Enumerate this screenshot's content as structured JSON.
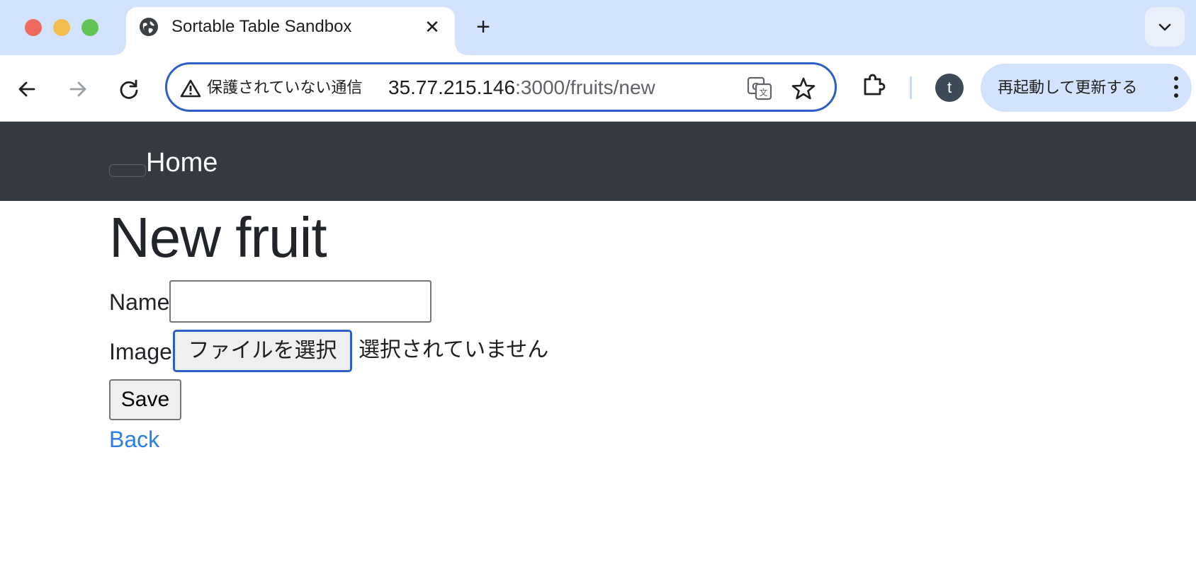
{
  "browser": {
    "tab_title": "Sortable Table Sandbox",
    "security_label": "保護されていない通信",
    "url_host": "35.77.215.146",
    "url_path": ":3000/fruits/new",
    "profile_initial": "t",
    "update_label": "再起動して更新する",
    "new_tab_symbol": "+",
    "close_symbol": "✕"
  },
  "navbar": {
    "brand": "Home"
  },
  "form": {
    "title": "New fruit",
    "name_label": "Name",
    "name_value": "",
    "image_label": "Image",
    "file_button_label": "ファイルを選択",
    "file_status": "選択されていません",
    "save_label": "Save",
    "back_label": "Back"
  },
  "colors": {
    "tabbar_bg": "#d3e3fd",
    "navbar_bg": "#343a40",
    "link": "#2b7de9",
    "focus_ring": "#2f5fc6"
  }
}
